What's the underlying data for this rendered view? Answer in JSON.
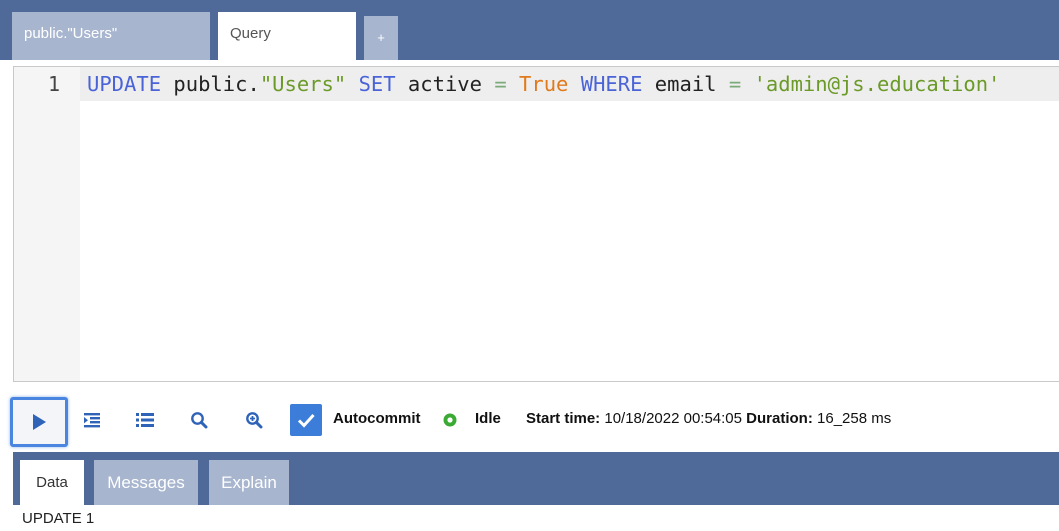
{
  "tabs": {
    "users": "public.\"Users\"",
    "query": "Query",
    "add": "+"
  },
  "editor": {
    "line_number": "1",
    "tokens": {
      "t1": "UPDATE",
      "t2": " public.",
      "t3": "\"Users\"",
      "t4": " ",
      "t5": "SET",
      "t6": " active ",
      "t7": "=",
      "t8": " ",
      "t9": "True",
      "t10": " ",
      "t11": "WHERE",
      "t12": " email ",
      "t13": "=",
      "t14": " ",
      "t15": "'admin@js.education'"
    }
  },
  "toolbar": {
    "icons": [
      "play-icon",
      "indent-list-icon",
      "list-icon",
      "search-icon",
      "zoom-in-icon",
      "checkmark-icon",
      "status-dot-icon"
    ],
    "autocommit_label": "Autocommit",
    "status": "Idle",
    "start_time_label": "Start time:",
    "start_time_value": "10/18/2022 00:54:05",
    "duration_label": "Duration:",
    "duration_value": "16_258 ms"
  },
  "results": {
    "tabs": {
      "data": "Data",
      "messages": "Messages",
      "explain": "Explain"
    },
    "output": "UPDATE 1"
  },
  "colors": {
    "header": "#4f6a98",
    "inactive_tab": "#a7b5cf",
    "keyword": "#4a64d8",
    "string": "#6c9a28",
    "boolean": "#e07a1c",
    "accent": "#3b7dd8",
    "status_idle": "#3aaa35"
  }
}
